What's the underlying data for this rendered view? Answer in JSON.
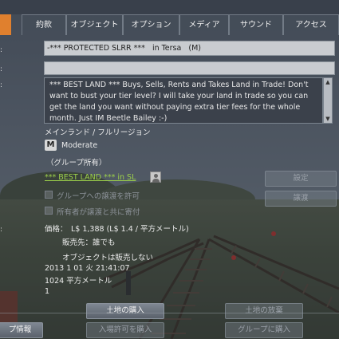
{
  "tabs": [
    {
      "label": "約款",
      "active": false
    },
    {
      "label": "オブジェクト",
      "active": false
    },
    {
      "label": "オプション",
      "active": false
    },
    {
      "label": "メディア",
      "active": false
    },
    {
      "label": "サウンド",
      "active": false
    },
    {
      "label": "アクセス",
      "active": false
    }
  ],
  "accent_color": "#e0802e",
  "parcel": {
    "name_value": "-*** PROTECTED SLRR ***   in Tersa   (M)",
    "second_field_value": "",
    "description": "*** BEST LAND ***   Buys, Sells, Rents and Takes Land in Trade!  Don't want to bust your tier level?  I will take your land in trade so you can get the land you want without paying extra tier fees for the whole month. Just IM Beetle Bailey :-)",
    "region_type": "メインランド / フルリージョン",
    "rating_badge": "M",
    "rating_label": "Moderate",
    "group_owned": "（グループ所有）",
    "owner_link": "*** BEST LAND ***   in SL",
    "owner_icon": "avatar-icon",
    "settings_button": "設定",
    "transfer_button": "譲渡",
    "checkbox_group_transfer": "グループへの譲渡を許可",
    "checkbox_owner_contribute": "所有者が譲渡と共に寄付",
    "price_label": "価格：",
    "price_value": "L$ 1,388   (L$ 1.4 / 平方メートル)",
    "sold_to": "販売先：誰でも",
    "objects_not_for_sale": "オブジェクトは販売しない",
    "date": "2013 1 01 火 21:41:07",
    "area": "1024 平方メートル",
    "count": "1",
    "buy_land_button": "土地の購入",
    "abandon_land_button": "土地の放棄",
    "buy_pass_button": "入場許可を購入",
    "buy_for_group_button": "グループに購入",
    "left_bottom_button": "プ情報"
  }
}
